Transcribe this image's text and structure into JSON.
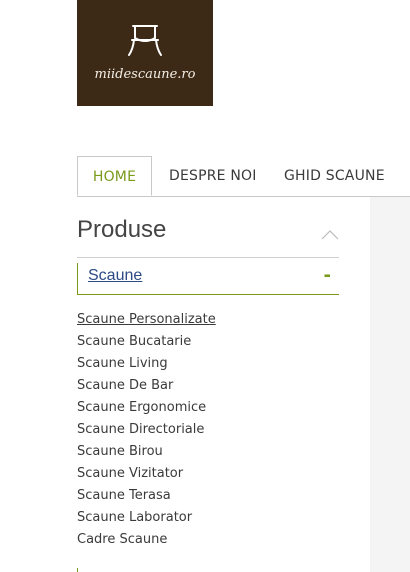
{
  "logo": {
    "text": "miidescaune.ro",
    "icon": "chair-icon"
  },
  "nav": {
    "tabs": [
      {
        "label": "HOME",
        "active": true
      },
      {
        "label": "DESPRE NOI"
      },
      {
        "label": "GHID SCAUNE"
      }
    ]
  },
  "sidebar": {
    "title": "Produse",
    "category": {
      "label": "Scaune",
      "toggle": "-"
    },
    "items": [
      "Scaune Personalizate",
      "Scaune Bucatarie",
      "Scaune Living",
      "Scaune De Bar",
      "Scaune Ergonomice",
      "Scaune Directoriale",
      "Scaune Birou",
      "Scaune Vizitator",
      "Scaune Terasa",
      "Scaune Laborator",
      "Cadre Scaune"
    ]
  },
  "colors": {
    "brand_brown": "#3d2a16",
    "accent_green": "#7a9a1c",
    "link_blue": "#2d4a85"
  }
}
